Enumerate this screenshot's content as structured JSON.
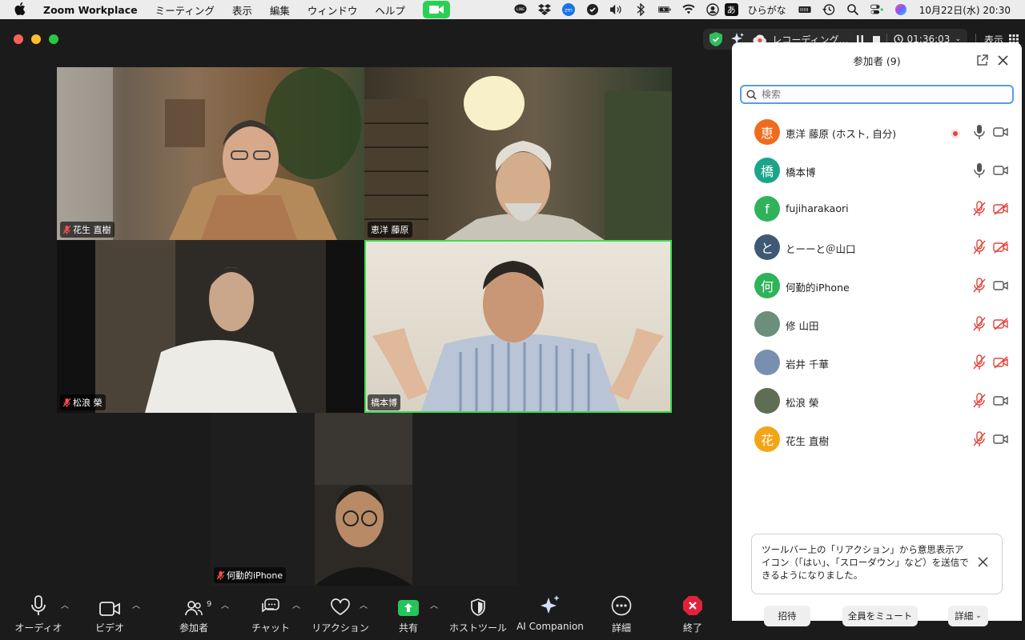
{
  "menubar": {
    "app_name": "Zoom Workplace",
    "menus": [
      "ミーティング",
      "表示",
      "編集",
      "ウィンドウ",
      "ヘルプ"
    ],
    "input_mode": "あ",
    "input_label": "ひらがな",
    "datetime": "10月22日(水)  20:30"
  },
  "titlebar": {
    "recording_label": "レコーディング…",
    "timer": "01:36:03",
    "view_label": "表示"
  },
  "gallery": {
    "tiles": [
      {
        "name": "花生 直樹",
        "muted": true,
        "active": false
      },
      {
        "name": "恵洋 藤原",
        "muted": false,
        "active": false
      },
      {
        "name": "松浪 榮",
        "muted": true,
        "active": false
      },
      {
        "name": "橋本博",
        "muted": false,
        "active": true
      },
      {
        "name": "何勤的iPhone",
        "muted": true,
        "active": false
      }
    ]
  },
  "toolbar": {
    "audio": "オーディオ",
    "video": "ビデオ",
    "participants": "参加者",
    "participants_count": "9",
    "chat": "チャット",
    "reactions": "リアクション",
    "share": "共有",
    "host_tools": "ホストツール",
    "ai_companion": "AI Companion",
    "more": "詳細",
    "end": "終了"
  },
  "panel": {
    "title": "参加者 (9)",
    "search_placeholder": "検索",
    "participants": [
      {
        "avatar": "恵",
        "color": "#ef6c1f",
        "name": "恵洋 藤原 (ホスト, 自分)",
        "mic_muted": false,
        "cam_off": false,
        "recording": true
      },
      {
        "avatar": "橋",
        "color": "#1aa58a",
        "name": "橋本博",
        "mic_muted": false,
        "cam_off": false,
        "recording": false
      },
      {
        "avatar": "f",
        "color": "#2fb35a",
        "name": "fujiharakaori",
        "mic_muted": true,
        "cam_off": true,
        "recording": false
      },
      {
        "avatar": "と",
        "color": "#3e5a73",
        "name": "とーーと＠山口",
        "mic_muted": true,
        "cam_off": true,
        "recording": false
      },
      {
        "avatar": "何",
        "color": "#2fb35a",
        "name": "何勤的iPhone",
        "mic_muted": true,
        "cam_off": false,
        "recording": false
      },
      {
        "avatar": "",
        "color": "#6b8f7a",
        "name": "修 山田",
        "mic_muted": true,
        "cam_off": true,
        "recording": false
      },
      {
        "avatar": "",
        "color": "#7a8fb0",
        "name": "岩井 千華",
        "mic_muted": true,
        "cam_off": true,
        "recording": false
      },
      {
        "avatar": "",
        "color": "#5d6e52",
        "name": "松浪 榮",
        "mic_muted": true,
        "cam_off": false,
        "recording": false
      },
      {
        "avatar": "花",
        "color": "#f2a516",
        "name": "花生 直樹",
        "mic_muted": true,
        "cam_off": false,
        "recording": false
      }
    ],
    "notice": "ツールバー上の「リアクション」から意思表示アイコン（「はい」、「スローダウン」など）を送信できるようになりました。",
    "invite": "招待",
    "mute_all": "全員をミュート",
    "more": "詳細"
  }
}
